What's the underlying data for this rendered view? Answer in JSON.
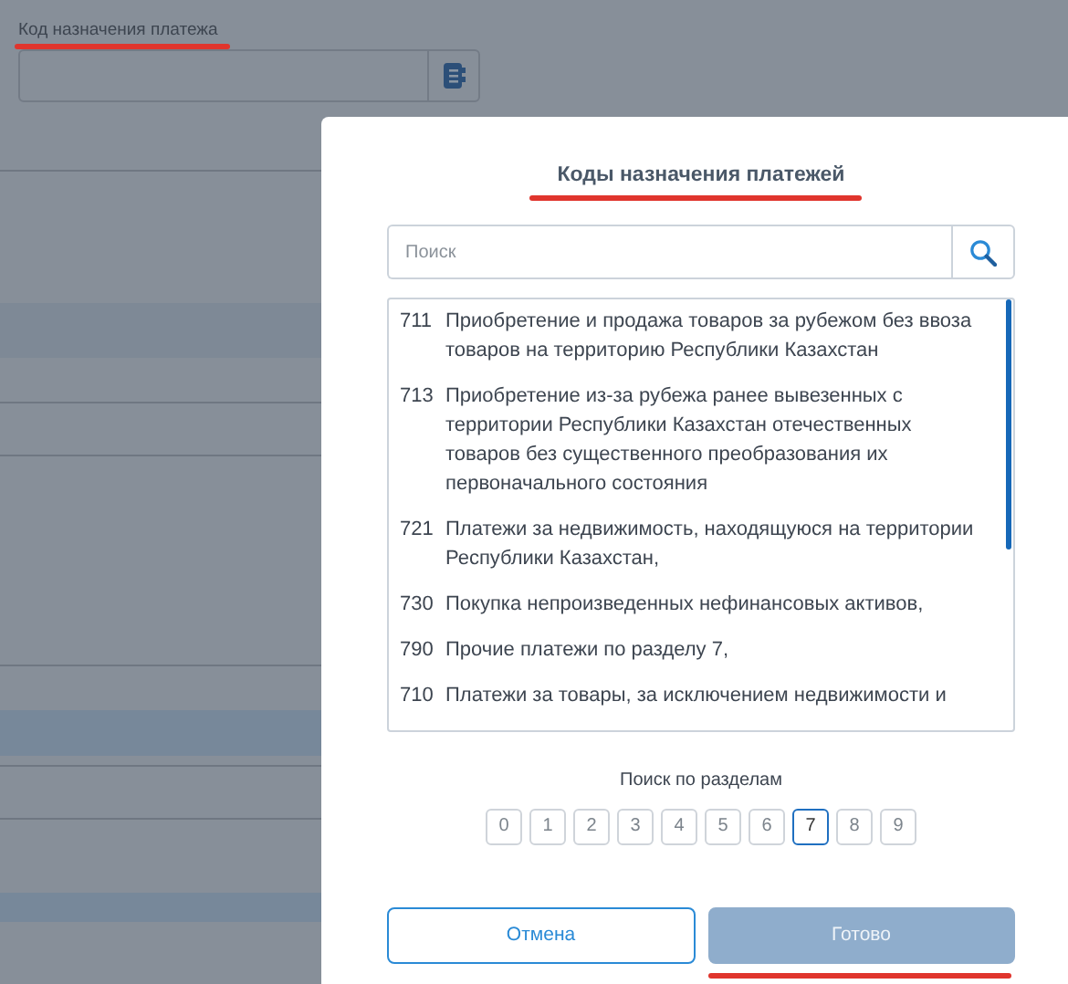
{
  "background_form": {
    "label": "Код назначения платежа"
  },
  "dialog": {
    "title": "Коды назначения платежей",
    "search": {
      "placeholder": "Поиск"
    },
    "codes": [
      {
        "code": "711",
        "text": "Приобретение и продажа товаров за рубежом без ввоза товаров на территорию Республики Казахстан"
      },
      {
        "code": "713",
        "text": "Приобретение из-за рубежа ранее вывезенных с территории Республики Казахстан отечественных товаров без существенного преобразования их первоначального состояния"
      },
      {
        "code": "721",
        "text": "Платежи за недвижимость, находящуюся на территории Республики Казахстан,"
      },
      {
        "code": "730",
        "text": "Покупка непроизведенных нефинансовых активов,"
      },
      {
        "code": "790",
        "text": "Прочие платежи по разделу 7,"
      },
      {
        "code": "710",
        "text": "Платежи за товары, за исключением недвижимости и"
      }
    ],
    "sections_label": "Поиск по разделам",
    "sections": [
      {
        "label": "0",
        "selected": false
      },
      {
        "label": "1",
        "selected": false
      },
      {
        "label": "2",
        "selected": false
      },
      {
        "label": "3",
        "selected": false
      },
      {
        "label": "4",
        "selected": false
      },
      {
        "label": "5",
        "selected": false
      },
      {
        "label": "6",
        "selected": false
      },
      {
        "label": "7",
        "selected": true
      },
      {
        "label": "8",
        "selected": false
      },
      {
        "label": "9",
        "selected": false
      }
    ],
    "buttons": [
      {
        "label": "Отмена",
        "kind": "outline",
        "disabled": false
      },
      {
        "label": "Готово",
        "kind": "primary",
        "disabled": true
      }
    ]
  }
}
